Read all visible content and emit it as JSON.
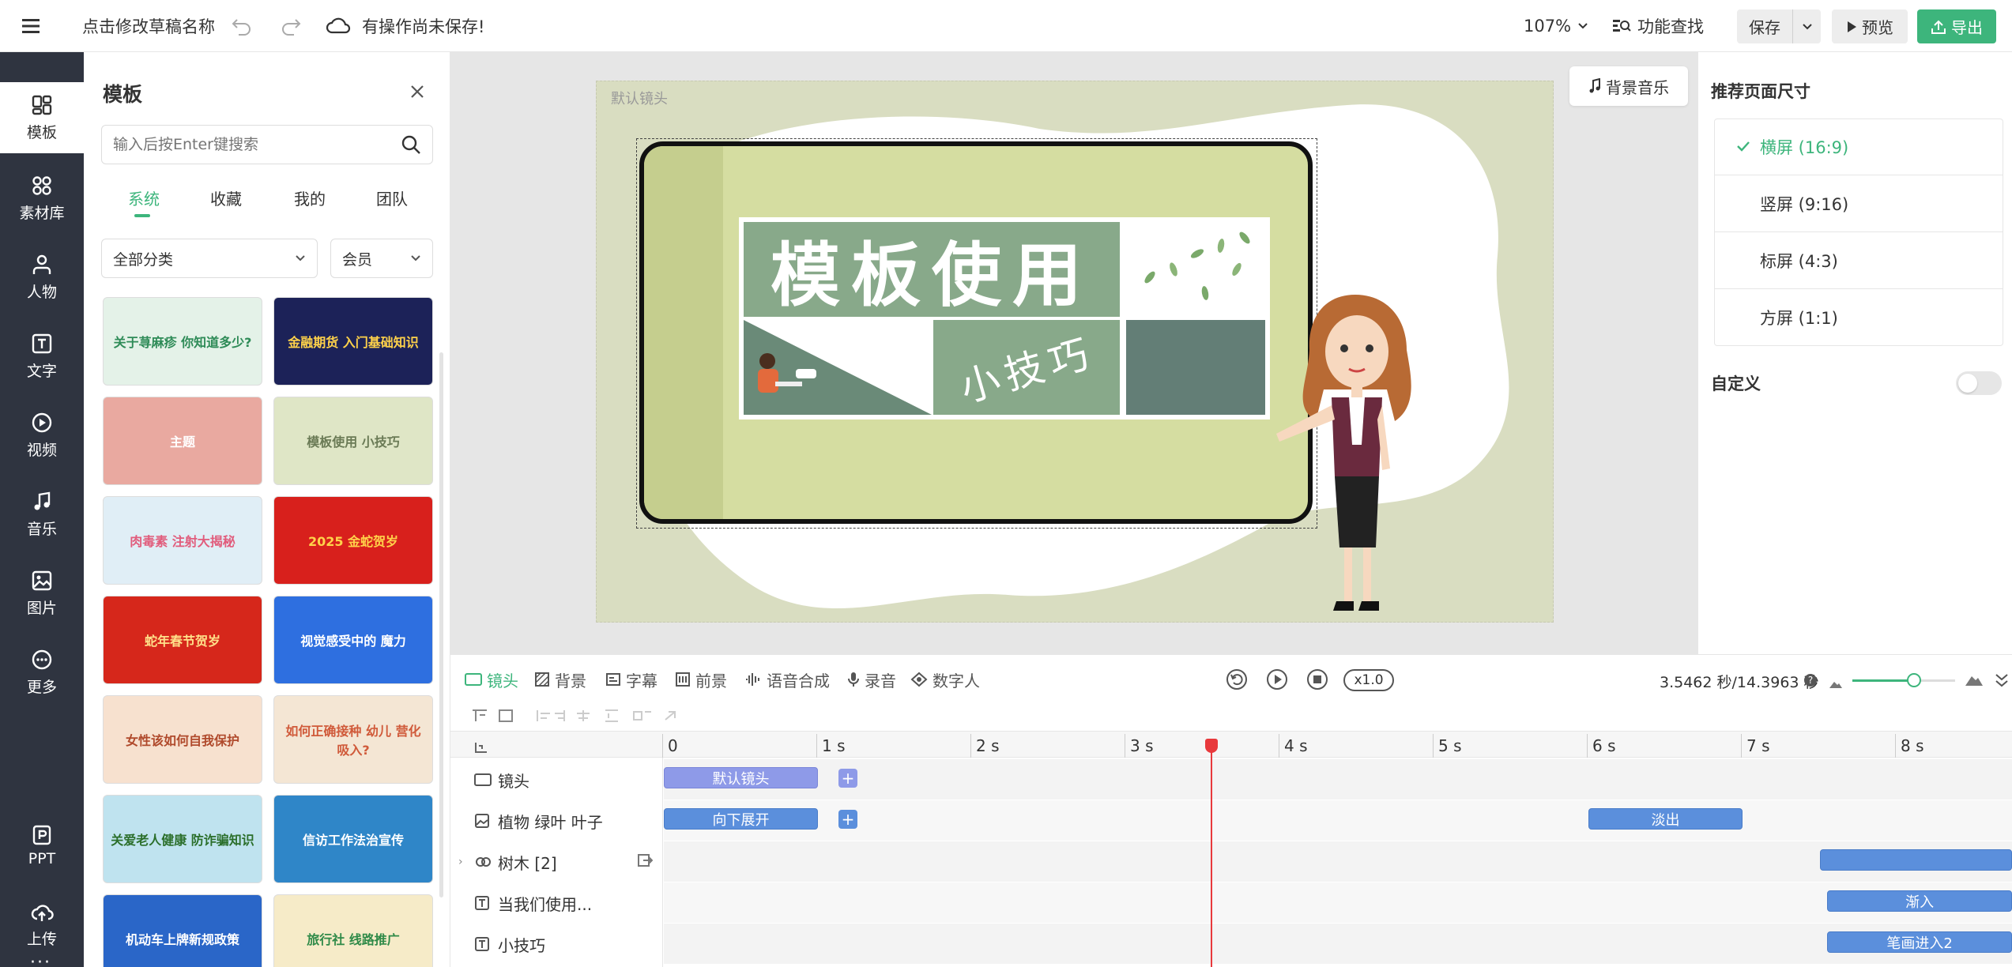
{
  "topbar": {
    "draft_name": "点击修改草稿名称",
    "unsaved_status": "有操作尚未保存!",
    "zoom": "107%",
    "feature_search": "功能查找",
    "save": "保存",
    "preview": "预览",
    "export": "导出"
  },
  "nav": {
    "items": [
      {
        "label": "模板",
        "icon": "template-icon"
      },
      {
        "label": "素材库",
        "icon": "material-icon"
      },
      {
        "label": "人物",
        "icon": "person-icon"
      },
      {
        "label": "文字",
        "icon": "text-icon"
      },
      {
        "label": "视频",
        "icon": "video-icon"
      },
      {
        "label": "音乐",
        "icon": "music-icon"
      },
      {
        "label": "图片",
        "icon": "image-icon"
      },
      {
        "label": "更多",
        "icon": "more-icon"
      }
    ],
    "ppt": "PPT",
    "upload": "上传"
  },
  "template_panel": {
    "title": "模板",
    "search_placeholder": "输入后按Enter键搜索",
    "tabs": [
      "系统",
      "收藏",
      "我的",
      "团队"
    ],
    "category_select": "全部分类",
    "member_select": "会员",
    "thumbnails": [
      {
        "text": "关于荨麻疹 你知道多少?",
        "bg": "#e4f2e8",
        "fg": "#2e8b57"
      },
      {
        "text": "金融期货 入门基础知识",
        "bg": "#1c2258",
        "fg": "#ffd24a"
      },
      {
        "text": "主题",
        "bg": "#e9a9a0",
        "fg": "#ffffff"
      },
      {
        "text": "模板使用 小技巧",
        "bg": "#dfe6c6",
        "fg": "#6a7a55"
      },
      {
        "text": "肉毒素 注射大揭秘",
        "bg": "#e0eef6",
        "fg": "#e15c7c"
      },
      {
        "text": "2025 金蛇贺岁",
        "bg": "#d8201c",
        "fg": "#ffd24a"
      },
      {
        "text": "蛇年春节贺岁",
        "bg": "#d6271b",
        "fg": "#ffe08a"
      },
      {
        "text": "视觉感受中的 魔力",
        "bg": "#2e6fe0",
        "fg": "#ffffff"
      },
      {
        "text": "女性该如何自我保护",
        "bg": "#f7e1cf",
        "fg": "#b04a2c"
      },
      {
        "text": "如何正确接种 幼儿 营化吸入?",
        "bg": "#f4e6d4",
        "fg": "#d05a3a"
      },
      {
        "text": "关爱老人健康 防诈骗知识",
        "bg": "#bfe3ef",
        "fg": "#2b6f2b"
      },
      {
        "text": "信访工作法治宣传",
        "bg": "#2f86c8",
        "fg": "#ffffff"
      },
      {
        "text": "机动车上牌新规政策",
        "bg": "#2a66c8",
        "fg": "#ffffff"
      },
      {
        "text": "旅行社 线路推广",
        "bg": "#f6ebc8",
        "fg": "#2f8a48"
      }
    ]
  },
  "stage": {
    "default_shot_label": "默认镜头",
    "bg_music": "背景音乐",
    "canvas_title": "模板使用",
    "canvas_subtitle": "小技巧"
  },
  "right_panel": {
    "title": "推荐页面尺寸",
    "sizes": [
      "横屏 (16:9)",
      "竖屏 (9:16)",
      "标屏 (4:3)",
      "方屏 (1:1)"
    ],
    "selected_index": 0,
    "custom_label": "自定义",
    "custom_enabled": false
  },
  "timeline": {
    "tabs": [
      "镜头",
      "背景",
      "字幕",
      "前景",
      "语音合成",
      "录音",
      "数字人"
    ],
    "speed": "x1.0",
    "time_display": "3.5462 秒/14.3963 秒",
    "ticks": [
      "0",
      "1 s",
      "2 s",
      "3 s",
      "4 s",
      "5 s",
      "6 s",
      "7 s",
      "8 s"
    ],
    "playhead_seconds": 3.5462,
    "zoom_level": 0.6,
    "rows": [
      {
        "label": "镜头",
        "icon": "camera-icon",
        "clips": [
          {
            "label": "默认镜头",
            "start": 0,
            "end": 1
          }
        ]
      },
      {
        "label": "植物 绿叶 叶子",
        "icon": "image-icon",
        "clips": [
          {
            "label": "向下展开",
            "start": 0,
            "end": 1
          },
          {
            "label": "淡出",
            "start": 6,
            "end": 7
          }
        ]
      },
      {
        "label": "树木 [2]",
        "icon": "group-icon",
        "clips": [
          {
            "label": "",
            "start": 7.5,
            "end": 8.8
          }
        ]
      },
      {
        "label": "当我们使用...",
        "icon": "text-icon",
        "clips": [
          {
            "label": "渐入",
            "start": 7.55,
            "end": 8.8
          }
        ]
      },
      {
        "label": "小技巧",
        "icon": "text-icon",
        "clips": [
          {
            "label": "笔画进入2",
            "start": 7.55,
            "end": 8.8
          }
        ]
      }
    ]
  },
  "colors": {
    "accent": "#3db57c",
    "nav_bg": "#2f3440",
    "playhead": "#e8393c",
    "clip_blue": "#5b8fdc",
    "clip_purple": "#8e9ae8"
  }
}
